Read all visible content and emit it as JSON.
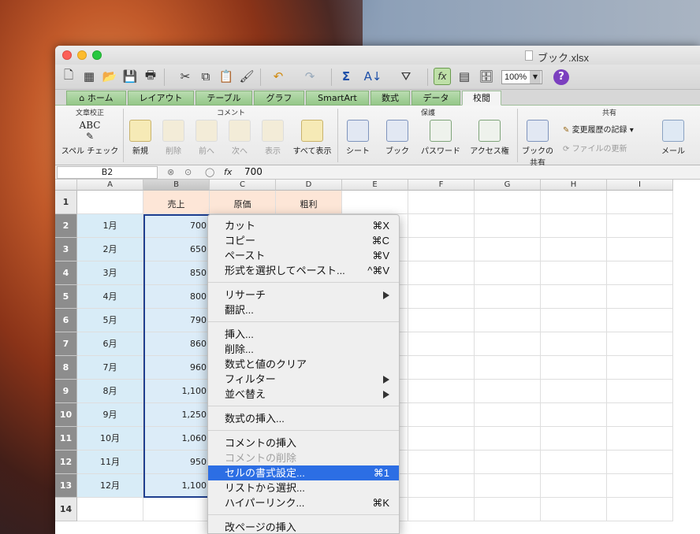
{
  "window": {
    "title": "ブック.xlsx"
  },
  "toolbar": {
    "zoom": "100%",
    "help": "?"
  },
  "ribbon_tabs": [
    "ホーム",
    "レイアウト",
    "テーブル",
    "グラフ",
    "SmartArt",
    "数式",
    "データ",
    "校閲"
  ],
  "ribbon_groups": {
    "proofing": "文章校正",
    "comments": "コメント",
    "protection": "保護",
    "share": "共有"
  },
  "ribbon": {
    "spell": "スペル チェック",
    "new": "新規",
    "delete": "削除",
    "prev": "前へ",
    "next": "次へ",
    "show": "表示",
    "show_all": "すべて表示",
    "sheet": "シート",
    "book": "ブック",
    "password": "パスワード",
    "access": "アクセス権",
    "share_book_1": "ブックの",
    "share_book_2": "共有",
    "track_changes": "変更履歴の記録",
    "update_file": "ファイルの更新",
    "mail": "メール"
  },
  "formula_bar": {
    "name_box": "B2",
    "fx": "fx",
    "value": "700"
  },
  "columns": [
    "A",
    "B",
    "C",
    "D",
    "E",
    "F",
    "G",
    "H",
    "I"
  ],
  "rows": [
    "1",
    "2",
    "3",
    "4",
    "5",
    "6",
    "7",
    "8",
    "9",
    "10",
    "11",
    "12",
    "13",
    "14"
  ],
  "sheet": {
    "headers": {
      "B": "売上",
      "C": "原価",
      "D": "粗利"
    },
    "months": [
      "1月",
      "2月",
      "3月",
      "4月",
      "5月",
      "6月",
      "7月",
      "8月",
      "9月",
      "10月",
      "11月",
      "12月"
    ],
    "sales": [
      "700",
      "650",
      "850",
      "800",
      "790",
      "860",
      "960",
      "1,100",
      "1,250",
      "1,060",
      "950",
      "1,100"
    ]
  },
  "context_menu": {
    "cut": "カット",
    "cut_sc": "⌘X",
    "copy": "コピー",
    "copy_sc": "⌘C",
    "paste": "ペースト",
    "paste_sc": "⌘V",
    "paste_special": "形式を選択してペースト...",
    "paste_special_sc": "^⌘V",
    "research": "リサーチ",
    "translate": "翻訳...",
    "insert": "挿入...",
    "delete": "削除...",
    "clear": "数式と値のクリア",
    "filter": "フィルター",
    "sort": "並べ替え",
    "insert_function": "数式の挿入...",
    "insert_comment": "コメントの挿入",
    "delete_comment": "コメントの削除",
    "format_cells": "セルの書式設定...",
    "format_cells_sc": "⌘1",
    "pick_from_list": "リストから選択...",
    "hyperlink": "ハイパーリンク...",
    "hyperlink_sc": "⌘K",
    "insert_page_break": "改ページの挿入"
  }
}
